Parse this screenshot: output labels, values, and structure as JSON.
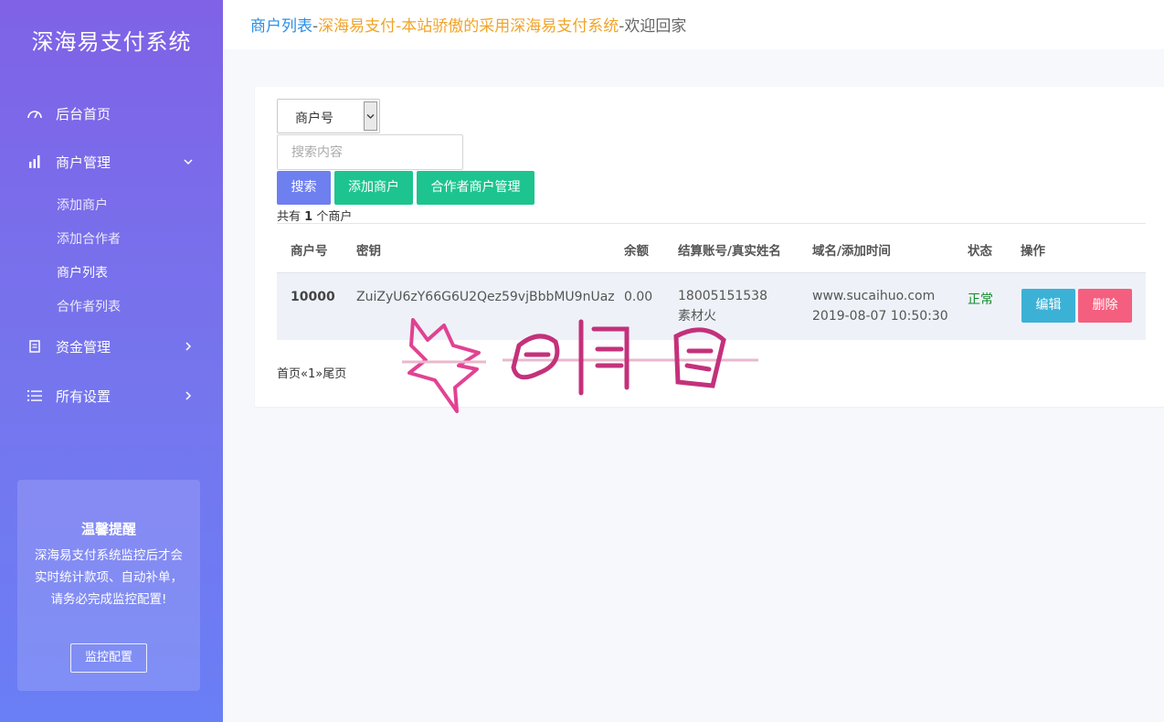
{
  "app": {
    "title": "深海易支付系统"
  },
  "sidebar": {
    "items": [
      {
        "label": "后台首页",
        "icon": "dashboard-gauge-icon"
      },
      {
        "label": "商户管理",
        "icon": "bar-chart-icon",
        "expanded": true,
        "children": [
          {
            "label": "添加商户"
          },
          {
            "label": "添加合作者"
          },
          {
            "label": "商户列表",
            "active": true
          },
          {
            "label": "合作者列表"
          }
        ]
      },
      {
        "label": "资金管理",
        "icon": "document-icon"
      },
      {
        "label": "所有设置",
        "icon": "list-icon"
      }
    ]
  },
  "tip": {
    "title": "温馨提醒",
    "text": "深海易支付系统监控后才会实时统计款项、自动补单，请务必完成监控配置!",
    "button": "监控配置"
  },
  "header": {
    "page": "商户列表",
    "sep": "-",
    "site_desc": "深海易支付-本站骄傲的采用深海易支付系统",
    "welcome": "欢迎回家"
  },
  "search": {
    "select_value": "商户号",
    "placeholder": "搜索内容",
    "search_button": "搜索",
    "add_button": "添加商户",
    "partner_button": "合作者商户管理"
  },
  "summary": {
    "prefix": "共有",
    "count": "1",
    "suffix": "个商户"
  },
  "table": {
    "headers": [
      "商户号",
      "密钥",
      "余额",
      "结算账号/真实姓名",
      "域名/添加时间",
      "状态",
      "操作"
    ],
    "rows": [
      {
        "id": "10000",
        "key": "ZuiZyU6zY66G6U2Qez59vjBbbMU9nUaz",
        "balance": "0.00",
        "account": "18005151538",
        "name": "素材火",
        "domain": "www.sucaihuo.com",
        "added": "2019-08-07 10:50:30",
        "status": "正常",
        "edit": "编辑",
        "delete": "删除"
      }
    ]
  },
  "pager": {
    "first": "首页",
    "prev": "«",
    "current": "1",
    "next": "»",
    "last": "尾页"
  },
  "colors": {
    "sidebar_top": "#7f62e6",
    "sidebar_bottom": "#6a7ef5",
    "primary": "#6e7ff0",
    "success": "#1dc48f",
    "info": "#3cb1d6",
    "danger": "#f55f7f",
    "status_ok": "#118a2a",
    "breadcrumb_link": "#2b8ee6",
    "breadcrumb_site": "#f0a428"
  }
}
